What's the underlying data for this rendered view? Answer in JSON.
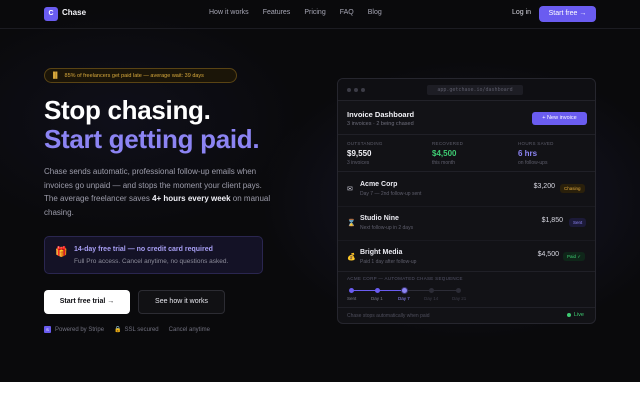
{
  "nav": {
    "logo_letter": "C",
    "brand": "Chase",
    "links": [
      "How it works",
      "Features",
      "Pricing",
      "FAQ",
      "Blog"
    ],
    "login": "Log in",
    "cta": "Start free →"
  },
  "hero": {
    "pill_icon": "chart-icon",
    "pill_text": "85% of freelancers get paid late — average wait: 39 days",
    "headline_1": "Stop chasing.",
    "headline_2": "Start getting paid.",
    "lead_1": "Chase sends automatic, professional follow-up emails when invoices go unpaid — and stops the moment your client pays. The average freelancer saves ",
    "lead_bold": "4+ hours every week",
    "lead_2": " on manual chasing.",
    "trial_icon": "gift-icon",
    "trial_title": "14-day free trial — no credit card required",
    "trial_sub": "Full Pro access. Cancel anytime, no questions asked.",
    "primary_button": "Start free trial →",
    "secondary_button": "See how it works",
    "trust": [
      "Powered by Stripe",
      "SSL secured",
      "Cancel anytime"
    ]
  },
  "dashboard": {
    "url": "app.getchase.io/dashboard",
    "title": "Invoice Dashboard",
    "subtitle": "3 invoices · 2 being chased",
    "new_invoice": "+ New invoice",
    "stats": [
      {
        "label": "OUTSTANDING",
        "value": "$9,550",
        "note": "3 invoices",
        "color": "#f2f2f7"
      },
      {
        "label": "RECOVERED",
        "value": "$4,500",
        "note": "this month",
        "color": "#3ecb72"
      },
      {
        "label": "HOURS SAVED",
        "value": "6 hrs",
        "note": "on follow-ups",
        "color": "#8c84f3"
      }
    ],
    "invoices": [
      {
        "icon": "mail-icon",
        "glyph": "✉",
        "client": "Acme Corp",
        "meta": "Day 7 — 2nd follow-up sent",
        "amount": "$3,200",
        "status": "Chasing",
        "status_color": "#e0a93c",
        "status_bg": "#2a200b"
      },
      {
        "icon": "hourglass-icon",
        "glyph": "⌛",
        "client": "Studio Nine",
        "meta": "Next follow-up in 2 days",
        "amount": "$1,850",
        "status": "Sent",
        "status_color": "#8c84f3",
        "status_bg": "#1c1a38"
      },
      {
        "icon": "money-bag-icon",
        "glyph": "💰",
        "client": "Bright Media",
        "meta": "Paid 1 day after follow-up",
        "amount": "$4,500",
        "status": "Paid ✓",
        "status_color": "#3ecb72",
        "status_bg": "#0f2619"
      }
    ],
    "sequence_label": "ACME CORP — AUTOMATED CHASE SEQUENCE",
    "sequence_steps": [
      {
        "label": "Sent",
        "state": "done"
      },
      {
        "label": "Day 1",
        "state": "done"
      },
      {
        "label": "Day 7",
        "state": "current"
      },
      {
        "label": "Day 14",
        "state": "pending"
      },
      {
        "label": "Day 21",
        "state": "pending"
      }
    ],
    "footer": "Chase stops automatically when paid",
    "live": "Live"
  }
}
